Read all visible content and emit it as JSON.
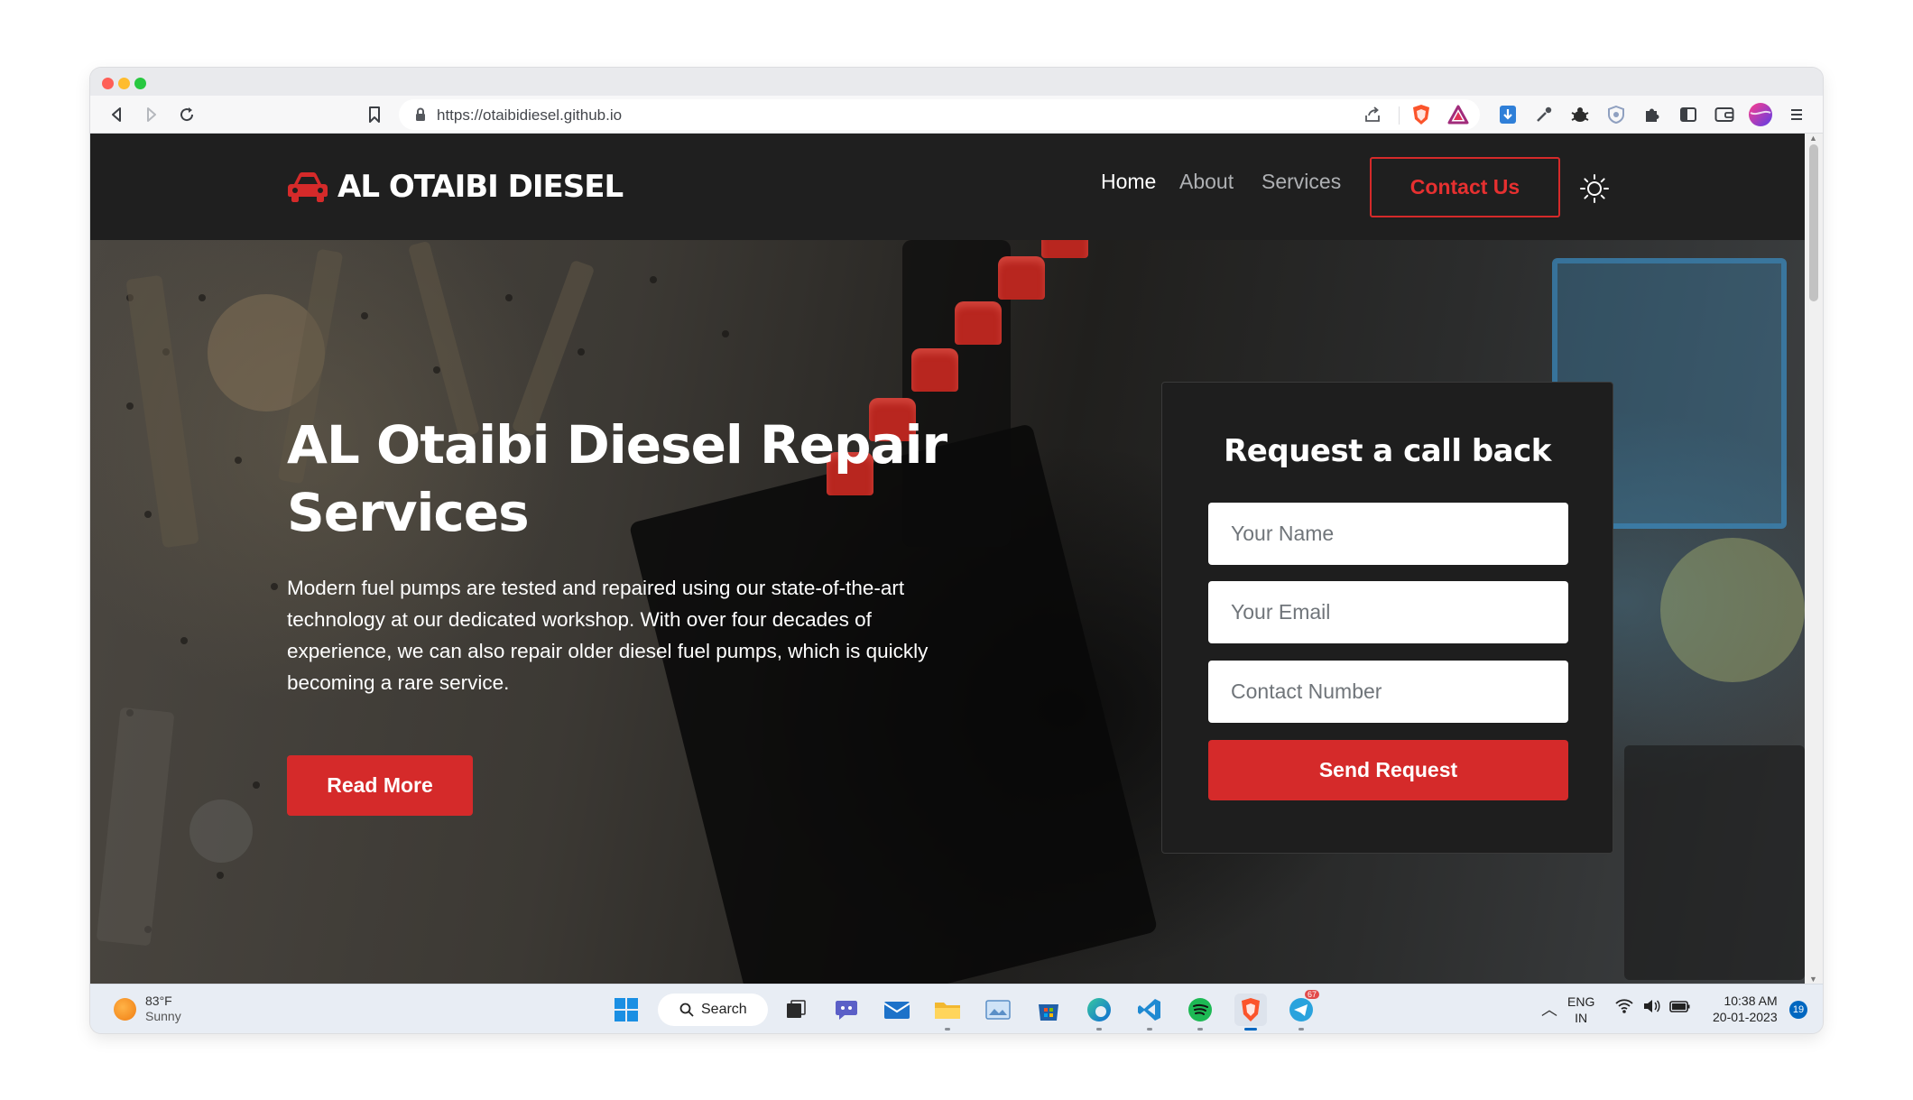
{
  "browser": {
    "url": "https://otaibidiesel.github.io"
  },
  "site": {
    "brand": "AL OTAIBI DIESEL",
    "nav": {
      "home": "Home",
      "about": "About",
      "services": "Services",
      "contact": "Contact Us"
    },
    "hero": {
      "title": "AL Otaibi Diesel Repair Services",
      "text": "Modern fuel pumps are tested and repaired using our state-of-the-art technology at our dedicated workshop. With over four decades of experience, we can also repair older diesel fuel pumps, which is quickly becoming a rare service.",
      "button": "Read More"
    },
    "form": {
      "title": "Request a call back",
      "name_placeholder": "Your Name",
      "email_placeholder": "Your Email",
      "phone_placeholder": "Contact Number",
      "submit": "Send Request"
    }
  },
  "taskbar": {
    "weather_temp": "83°F",
    "weather_desc": "Sunny",
    "search_label": "Search",
    "lang_1": "ENG",
    "lang_2": "IN",
    "time": "10:38 AM",
    "date": "20-01-2023",
    "notification_count": "19",
    "telegram_badge": "67"
  },
  "colors": {
    "accent": "#d52a2a",
    "nav_bg": "#1f1f1f"
  }
}
